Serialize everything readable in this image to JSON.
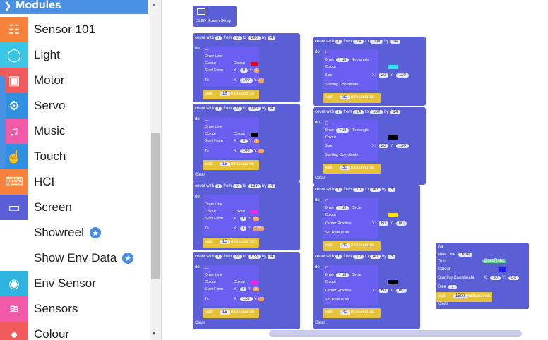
{
  "sidebar": {
    "header": "Modules",
    "items": [
      {
        "label": "Sensor 101",
        "icon": "sensor-tree-icon",
        "color": "#f5813a",
        "star": false
      },
      {
        "label": "Light",
        "icon": "bulb-icon",
        "color": "#38c5e6",
        "star": false
      },
      {
        "label": "Motor",
        "icon": "basket-icon",
        "color": "#f05a5a",
        "star": false
      },
      {
        "label": "Servo",
        "icon": "gear-icon",
        "color": "#2f8fe0",
        "star": false
      },
      {
        "label": "Music",
        "icon": "music-note-icon",
        "color": "#f05aa8",
        "star": false
      },
      {
        "label": "Touch",
        "icon": "hand-icon",
        "color": "#2f8fe0",
        "star": false
      },
      {
        "label": "HCI",
        "icon": "keyboard-icon",
        "color": "#f5813a",
        "star": false
      },
      {
        "label": "Screen",
        "icon": "laptop-icon",
        "color": "#5b5fd6",
        "star": false
      },
      {
        "label": "Showreel",
        "icon": "",
        "color": "",
        "star": true
      },
      {
        "label": "Show Env Data",
        "icon": "",
        "color": "",
        "star": true
      },
      {
        "label": "Env Sensor",
        "icon": "globe-icon",
        "color": "#2fb3e0",
        "star": false
      },
      {
        "label": "Sensors",
        "icon": "signal-icon",
        "color": "#f05aa8",
        "star": false
      },
      {
        "label": "Colour",
        "icon": "palette-icon",
        "color": "#f05a5a",
        "star": false
      }
    ]
  },
  "workspace": {
    "oled_setup": "OLED Screen Setup",
    "col1": [
      {
        "header": [
          "count with",
          "i",
          "from",
          "0",
          "to",
          "100",
          "by",
          "4"
        ],
        "title": "Draw Line",
        "colour": "#e0001b",
        "rows": [
          "Colour",
          "Start From",
          "To"
        ],
        "sx": "0",
        "sy": "i",
        "tx": "100",
        "ty": "i",
        "wait": "15",
        "clear": false
      },
      {
        "header": [
          "count with",
          "i",
          "from",
          "0",
          "to",
          "100",
          "by",
          "4"
        ],
        "title": "Draw Line",
        "colour": "#000000",
        "rows": [
          "Colour",
          "Start From",
          "To"
        ],
        "sx": "0",
        "sy": "i",
        "tx": "100",
        "ty": "i",
        "wait": "15",
        "clear": true
      },
      {
        "header": [
          "count with",
          "i",
          "from",
          "0",
          "to",
          "128",
          "by",
          "4"
        ],
        "title": "Draw Line",
        "colour": "#ff20e6",
        "rows": [
          "Colour",
          "Start From",
          "To"
        ],
        "sx": "i",
        "sy": "0",
        "tx": "i",
        "ty": "128",
        "wait": "15",
        "clear": false
      },
      {
        "header": [
          "count with",
          "i",
          "from",
          "0",
          "to",
          "128",
          "by",
          "4"
        ],
        "title": "Draw Line",
        "colour": "#ff20e6",
        "rows": [
          "Colour",
          "Start From",
          "To"
        ],
        "sx": "i",
        "sy": "0",
        "tx": "128",
        "ty": "i",
        "wait": "15",
        "clear": true
      }
    ],
    "col2": [
      {
        "header": [
          "count with",
          "i",
          "from",
          "14",
          "to",
          "100",
          "by",
          "14"
        ],
        "title": "Draw",
        "shape": "Rectangle",
        "fill": "Full",
        "colour": "#2ee6f0",
        "wait": "30",
        "clear": false,
        "sx": "20",
        "sy": "120"
      },
      {
        "header": [
          "count with",
          "i",
          "from",
          "14",
          "to",
          "100",
          "by",
          "14"
        ],
        "title": "Draw",
        "shape": "Rectangle",
        "fill": "Full",
        "colour": "#000000",
        "wait": "30",
        "clear": true,
        "sx": "20",
        "sy": "120"
      },
      {
        "header": [
          "count with",
          "i",
          "from",
          "10",
          "to",
          "40",
          "by",
          "5"
        ],
        "title": "Draw",
        "shape": "Circle",
        "fill": "Full",
        "colour": "#ffe600",
        "wait": "40",
        "clear": false,
        "sx": "60",
        "sy": "60"
      },
      {
        "header": [
          "count with",
          "i",
          "from",
          "10",
          "to",
          "40",
          "by",
          "5"
        ],
        "title": "Draw",
        "shape": "Circle",
        "fill": "Full",
        "colour": "#000000",
        "wait": "40",
        "clear": true,
        "sx": "60",
        "sy": "60"
      }
    ],
    "text_block": {
      "title": "Aa",
      "newline_label": "New Line",
      "newline_value": "True",
      "text_label": "Text",
      "text_value": "CocoRobo",
      "colour_label": "Colour",
      "start_label": "Starting Coordinate",
      "x": "30",
      "y": "30",
      "size_label": "Size",
      "size": "1",
      "wait": "1500",
      "clear": "Clear"
    },
    "labels": {
      "do": "do",
      "milliseconds": "milliseconds",
      "wait": "wait",
      "clear": "Clear",
      "size": "Size",
      "width": "Width",
      "height": "Height",
      "start_coord": "Starting Coordinate",
      "center": "Center Position",
      "radius": "Set Radius as",
      "colour": "Colour"
    }
  }
}
